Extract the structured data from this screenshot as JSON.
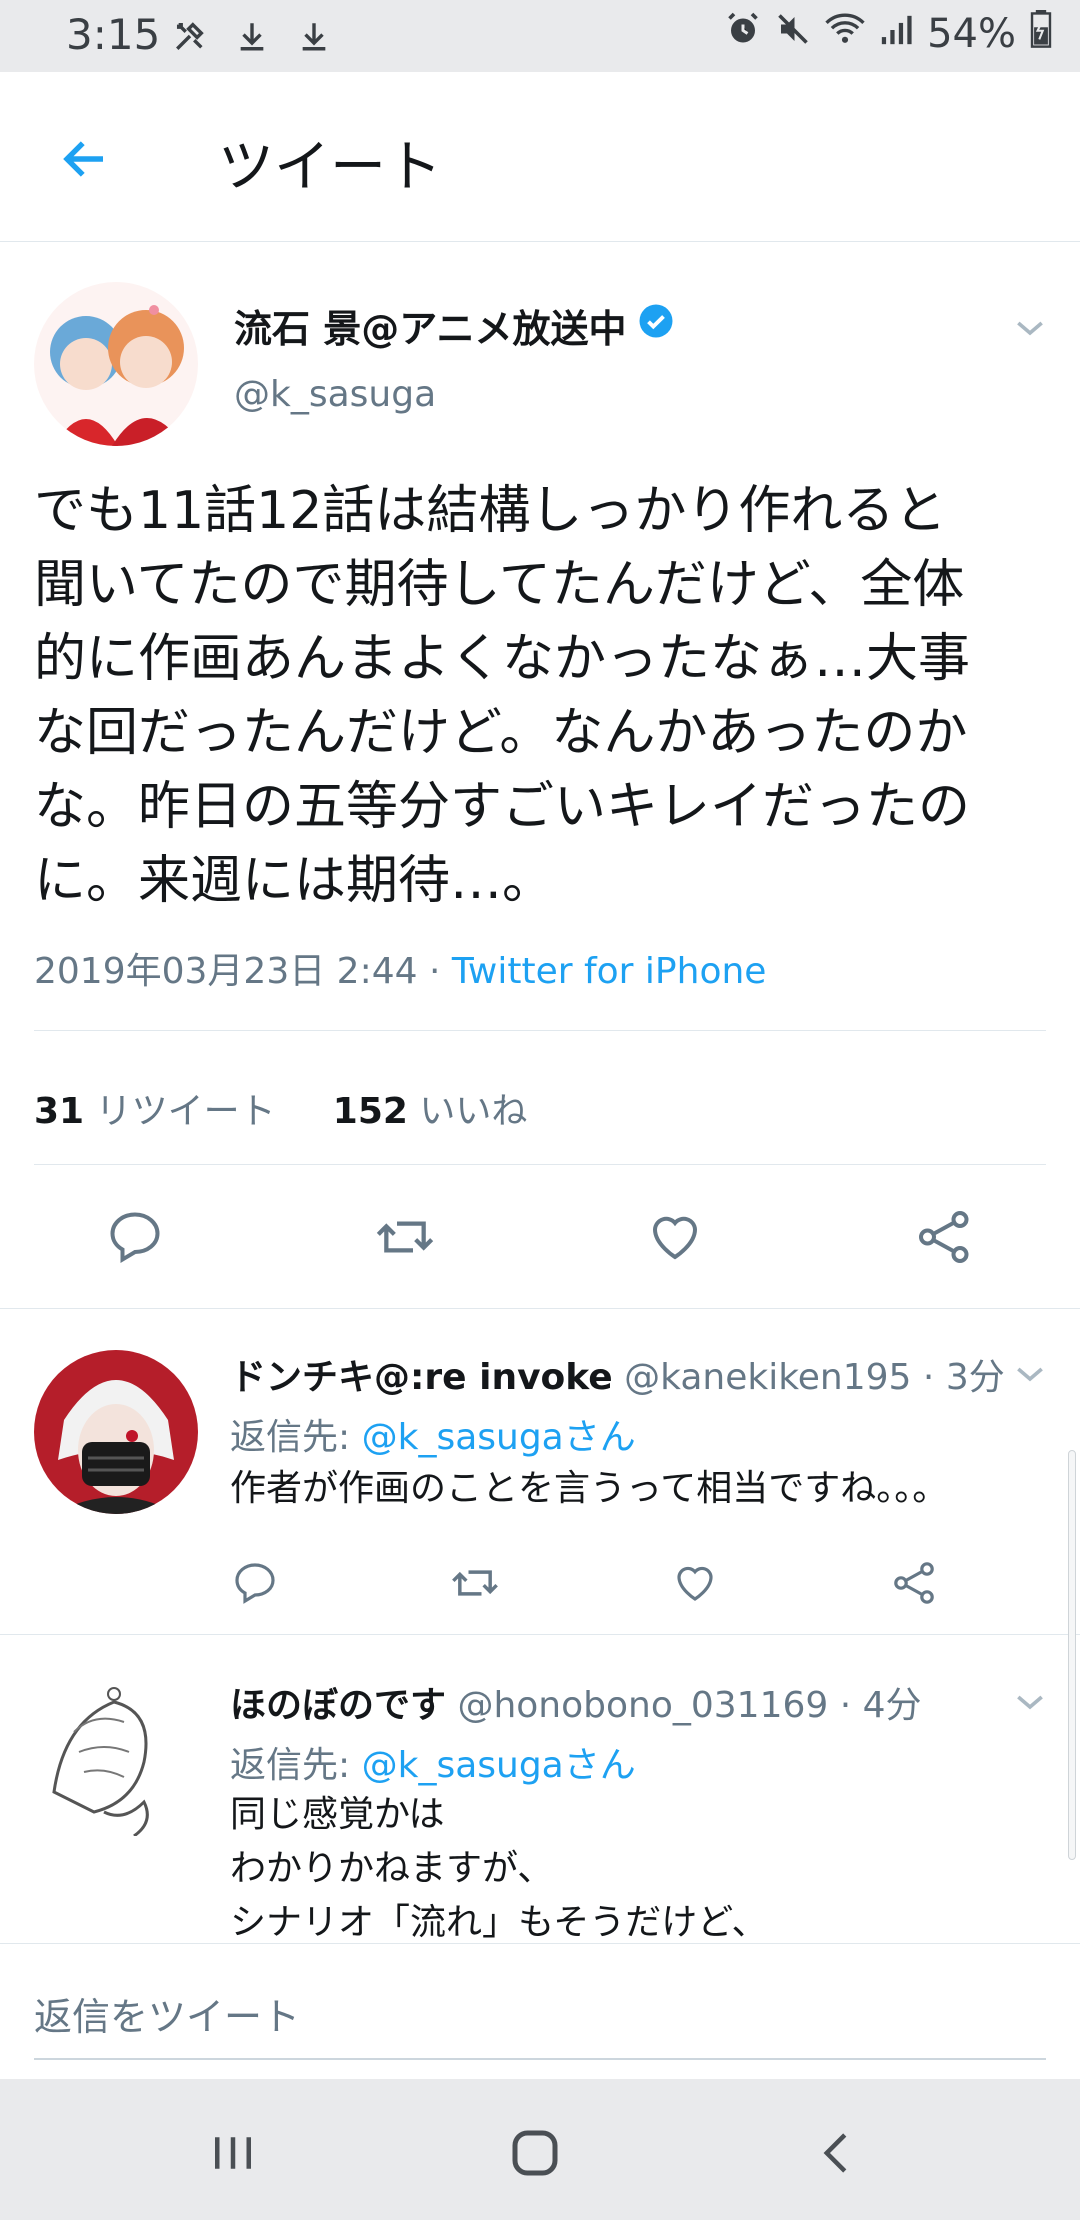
{
  "status_bar": {
    "time": "3:15",
    "battery": "54%",
    "left_icons": [
      "tools-icon",
      "download-icon",
      "download-icon"
    ],
    "right_icons": [
      "alarm-icon",
      "mute-icon",
      "wifi-icon",
      "signal-icon",
      "battery-icon"
    ]
  },
  "app_bar": {
    "title": "ツイート",
    "back_icon": "arrow-left-icon"
  },
  "main_tweet": {
    "author_name": "流石 景@アニメ放送中",
    "handle": "@k_sasuga",
    "verified": true,
    "text_lines": [
      "でも11話12話は結構しっかり作れると",
      "聞いてたので期待してたんだけど、全体",
      "的に作画あんまよくなかったなぁ…大事",
      "な回だったんだけど。なんかあったのか",
      "な。昨日の五等分すごいキレイだったの",
      "に。来週には期待…。"
    ],
    "timestamp": "2019年03月23日 2:44",
    "separator": " · ",
    "source": "Twitter for iPhone",
    "retweet_count": "31",
    "retweet_label": "リツイート",
    "like_count": "152",
    "like_label": "いいね"
  },
  "replies": [
    {
      "name": "ドンチキ@:re invoke",
      "handle": "@kanekiken195",
      "time": "3分",
      "reply_to_label": "返信先:",
      "reply_to": "@k_sasugaさん",
      "text_lines": [
        "作者が作画のことを言うって相当ですね。。。"
      ]
    },
    {
      "name": "ほのぼのです",
      "handle": "@honobono_031169",
      "time": "4分",
      "reply_to_label": "返信先:",
      "reply_to": "@k_sasugaさん",
      "text_lines": [
        "同じ感覚かは",
        "わかりかねますが、",
        "シナリオ「流れ」もそうだけど、"
      ]
    }
  ],
  "compose": {
    "placeholder": "返信をツイート"
  },
  "colors": {
    "accent": "#1da1f2",
    "muted": "#657786",
    "text": "#14171a",
    "divider": "#e1e8ed"
  }
}
